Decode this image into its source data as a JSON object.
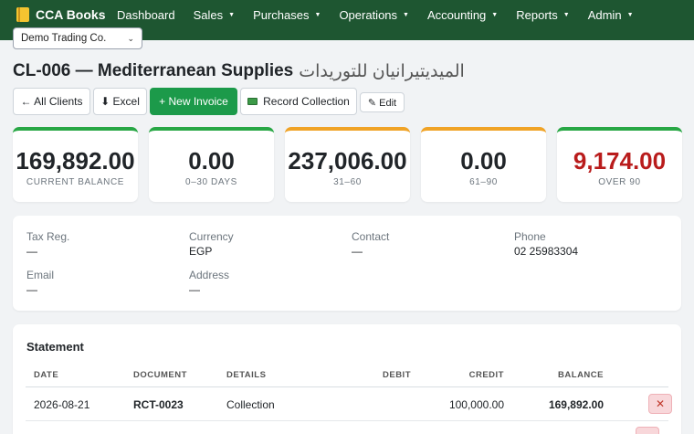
{
  "app": {
    "title": "CCA Books",
    "icon": "ledger-book-icon"
  },
  "nav": {
    "items": [
      {
        "label": "Dashboard",
        "dropdown": false
      },
      {
        "label": "Sales",
        "dropdown": true
      },
      {
        "label": "Purchases",
        "dropdown": true
      },
      {
        "label": "Operations",
        "dropdown": true
      },
      {
        "label": "Accounting",
        "dropdown": true
      },
      {
        "label": "Reports",
        "dropdown": true
      },
      {
        "label": "Admin",
        "dropdown": true
      }
    ]
  },
  "company_selector": {
    "value": "Demo Trading Co."
  },
  "client": {
    "code_title": "CL-006 — Mediterranean Supplies",
    "arabic_name": "الميديتيرانيان للتوريدات"
  },
  "actions": {
    "all_clients": "← All Clients",
    "excel": "⬇ Excel",
    "new_invoice": "+ New Invoice",
    "record_collection": "Record Collection",
    "edit": "✎ Edit"
  },
  "kpis": [
    {
      "value": "169,892.00",
      "label": "CURRENT BALANCE",
      "accent": "#28a745"
    },
    {
      "value": "0.00",
      "label": "0–30 DAYS",
      "accent": "#28a745"
    },
    {
      "value": "237,006.00",
      "label": "31–60",
      "accent": "#f0a326"
    },
    {
      "value": "0.00",
      "label": "61–90",
      "accent": "#f0a326"
    },
    {
      "value": "9,174.00",
      "label": "OVER 90",
      "accent": "#28a745",
      "value_color": "#b91c1c"
    }
  ],
  "info": {
    "tax_reg": {
      "label": "Tax Reg.",
      "value": "—"
    },
    "currency": {
      "label": "Currency",
      "value": "EGP"
    },
    "contact": {
      "label": "Contact",
      "value": "—"
    },
    "phone": {
      "label": "Phone",
      "value": "02 25983304"
    },
    "email": {
      "label": "Email",
      "value": "—"
    },
    "address": {
      "label": "Address",
      "value": "—"
    }
  },
  "statement": {
    "title": "Statement",
    "columns": [
      "DATE",
      "DOCUMENT",
      "DETAILS",
      "DEBIT",
      "CREDIT",
      "BALANCE"
    ],
    "rows": [
      {
        "date": "2026-08-21",
        "document": "RCT-0023",
        "details": "Collection",
        "debit": "",
        "credit": "100,000.00",
        "balance": "169,892.00"
      }
    ]
  }
}
